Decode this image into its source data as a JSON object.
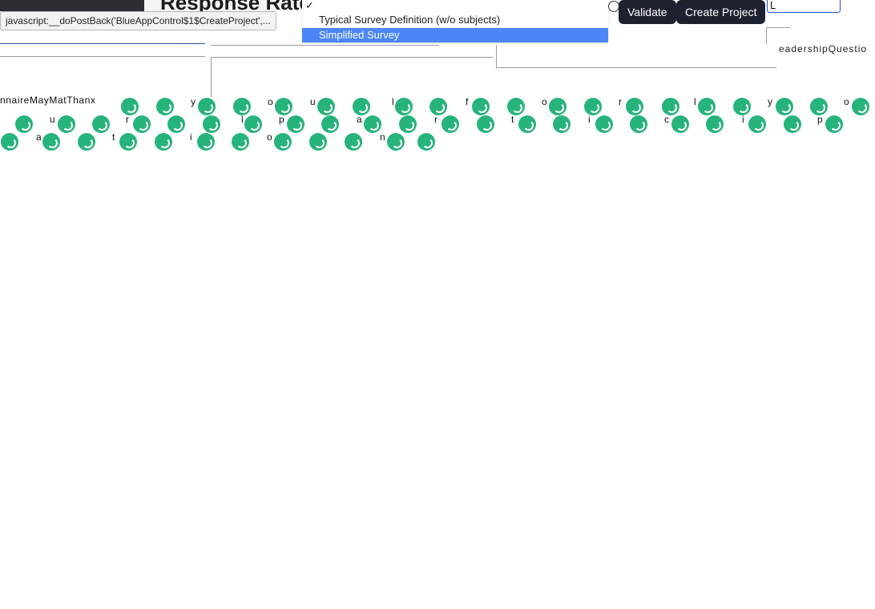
{
  "page": {
    "title": "Response Rate",
    "status_tooltip": "javascript:__doPostBack('BlueAppControl$1$CreateProject',..."
  },
  "dropdown": {
    "check": "✓",
    "options": [
      {
        "label": "Typical Survey Definition (w/o subjects)",
        "selected": false
      },
      {
        "label": "Simplified Survey",
        "selected": true
      }
    ]
  },
  "toolbar": {
    "validate_label": "Validate",
    "create_label": "Create Project"
  },
  "search": {
    "value": "L"
  },
  "right_label": "eadershipQuestio",
  "rows": {
    "row1_text": "nnaireMayMatThanx",
    "row1_glyphs": [
      "y",
      "o",
      "u",
      "l",
      "f",
      "o",
      "r",
      "l",
      "y",
      "o"
    ],
    "row2_glyphs": [
      "u",
      "r",
      "l",
      "p",
      "a",
      "r",
      "t",
      "i",
      "c",
      "i",
      "p"
    ],
    "row3_glyphs": [
      "a",
      "t",
      "i",
      "o",
      "n"
    ]
  },
  "colors": {
    "spinner": "#27b37c",
    "button_bg": "#1e2230",
    "selection": "#4a86f7"
  }
}
